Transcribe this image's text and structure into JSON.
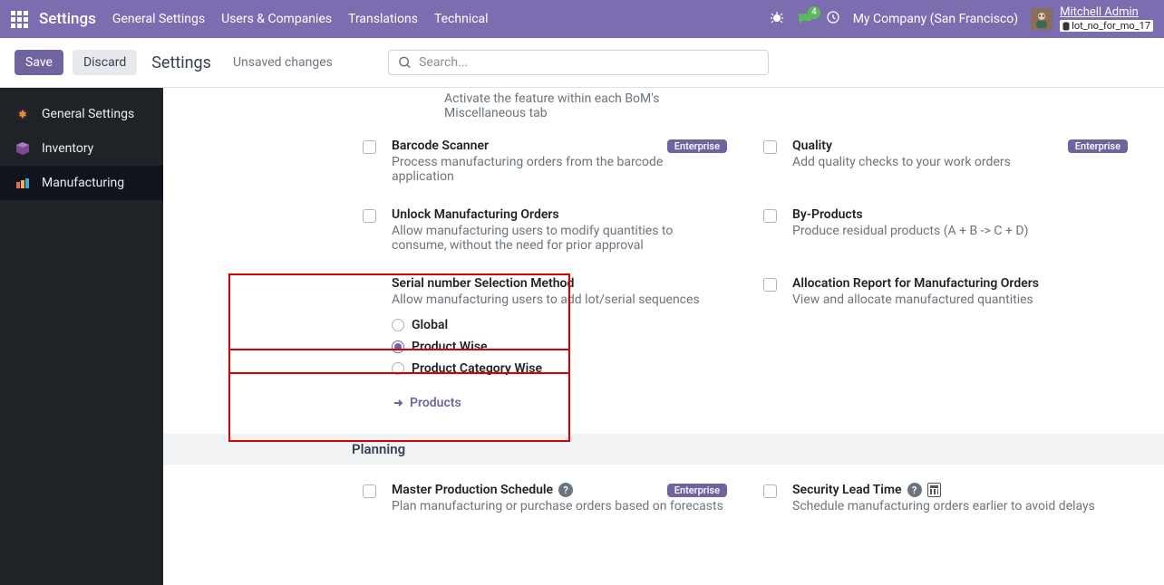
{
  "top": {
    "brand": "Settings",
    "menu": [
      "General Settings",
      "Users & Companies",
      "Translations",
      "Technical"
    ],
    "chat_count": "4",
    "company": "My Company (San Francisco)",
    "user": "Mitchell Admin",
    "db": "lot_no_for_mo_17"
  },
  "control": {
    "save": "Save",
    "discard": "Discard",
    "breadcrumb": "Settings",
    "unsaved": "Unsaved changes",
    "search_placeholder": "Search..."
  },
  "sidebar": {
    "items": [
      {
        "label": "General Settings"
      },
      {
        "label": "Inventory"
      },
      {
        "label": "Manufacturing"
      }
    ]
  },
  "truncated": "Activate the feature within each BoM's Miscellaneous tab",
  "settings": {
    "barcode": {
      "title": "Barcode Scanner",
      "desc": "Process manufacturing orders from the barcode application",
      "enterprise": "Enterprise"
    },
    "quality": {
      "title": "Quality",
      "desc": "Add quality checks to your work orders",
      "enterprise": "Enterprise"
    },
    "unlock": {
      "title": "Unlock Manufacturing Orders",
      "desc": "Allow manufacturing users to modify quantities to consume, without the need for prior approval"
    },
    "byproducts": {
      "title": "By-Products",
      "desc": "Produce residual products (A + B -> C + D)"
    },
    "serial": {
      "title": "Serial number Selection Method",
      "desc": "Allow manufacturing users to add lot/serial sequences",
      "options": {
        "global": "Global",
        "product": "Product Wise",
        "category": "Product Category Wise"
      },
      "link": "Products"
    },
    "alloc": {
      "title": "Allocation Report for Manufacturing Orders",
      "desc": "View and allocate manufactured quantities"
    },
    "section_planning": "Planning",
    "mps": {
      "title": "Master Production Schedule",
      "desc": "Plan manufacturing or purchase orders based on forecasts",
      "enterprise": "Enterprise"
    },
    "lead": {
      "title": "Security Lead Time",
      "desc": "Schedule manufacturing orders earlier to avoid delays"
    }
  }
}
